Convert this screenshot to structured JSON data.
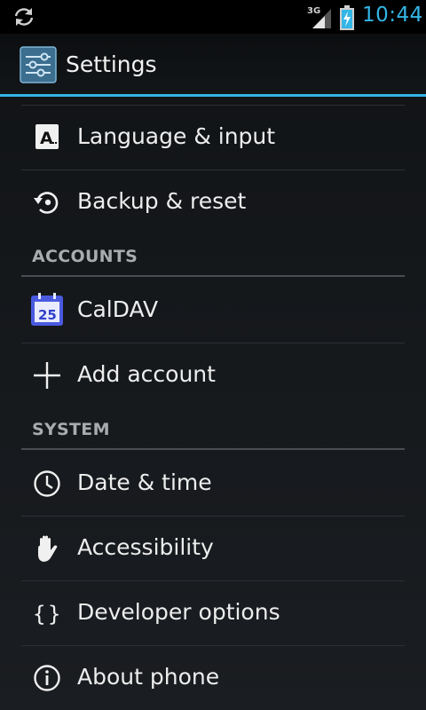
{
  "status_bar": {
    "clock": "10:44",
    "network_type": "3G",
    "icons": [
      "sync-icon",
      "signal-icon",
      "battery-charging-icon"
    ]
  },
  "action_bar": {
    "title": "Settings",
    "icon": "settings-app-icon"
  },
  "sections": {
    "personal_tail": [
      {
        "label": "Language & input",
        "icon": "language-icon"
      },
      {
        "label": "Backup & reset",
        "icon": "backup-restore-icon"
      }
    ],
    "accounts": {
      "header": "ACCOUNTS",
      "items": [
        {
          "label": "CalDAV",
          "icon": "calendar-icon",
          "icon_text": "25"
        },
        {
          "label": "Add account",
          "icon": "plus-icon"
        }
      ]
    },
    "system": {
      "header": "SYSTEM",
      "items": [
        {
          "label": "Date & time",
          "icon": "clock-icon"
        },
        {
          "label": "Accessibility",
          "icon": "hand-icon"
        },
        {
          "label": "Developer options",
          "icon": "braces-icon"
        },
        {
          "label": "About phone",
          "icon": "info-icon"
        }
      ]
    }
  },
  "colors": {
    "accent": "#33b5e5",
    "text": "#ededed",
    "header_text": "#a9acaf",
    "calendar_icon": "#4a5ae0"
  }
}
